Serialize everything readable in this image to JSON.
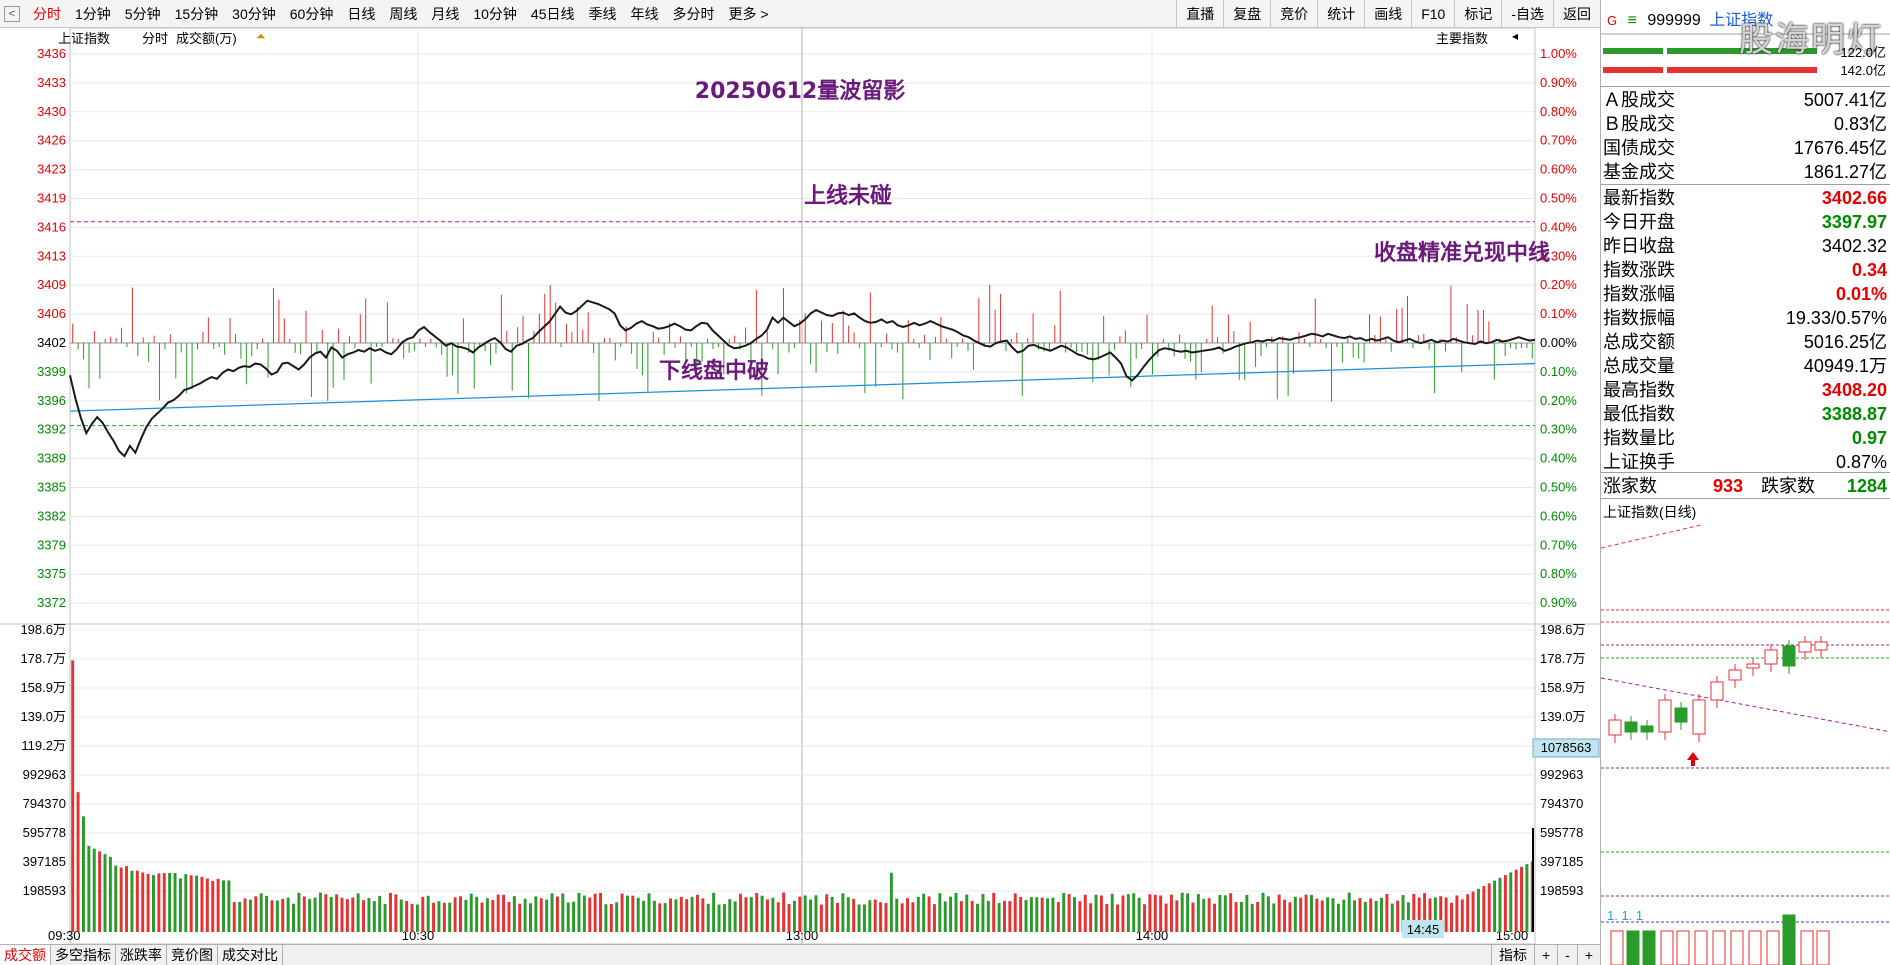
{
  "toolbar": {
    "back_label": "<",
    "period_tabs": [
      "分时",
      "1分钟",
      "5分钟",
      "15分钟",
      "30分钟",
      "60分钟",
      "日线",
      "周线",
      "月线",
      "10分钟",
      "45日线",
      "季线",
      "年线",
      "多分时",
      "更多 >"
    ],
    "tool_buttons": [
      "直播",
      "复盘",
      "竞价",
      "统计",
      "画线",
      "F10",
      "标记",
      "-自选",
      "返回"
    ]
  },
  "chart": {
    "header": {
      "index_name": "上证指数",
      "mode": "分时",
      "indicator": "成交额(万)",
      "main_indicator": "主要指数"
    },
    "annotations": {
      "title": "20250612量波留影",
      "upper": "上线未碰",
      "lower": "下线盘中破",
      "close": "收盘精准兑现中线"
    },
    "cursor_value": "1078563",
    "time_cursor": "14:45"
  },
  "chart_data": {
    "type": "line",
    "title": "",
    "price_axis": [
      "3436",
      "3433",
      "3430",
      "3426",
      "3423",
      "3419",
      "3416",
      "3413",
      "3409",
      "3406",
      "3402",
      "3399",
      "3396",
      "3392",
      "3389",
      "3385",
      "3382",
      "3379",
      "3375",
      "3372"
    ],
    "pct_axis": [
      "1.00%",
      "0.90%",
      "0.80%",
      "0.70%",
      "0.60%",
      "0.50%",
      "0.40%",
      "0.30%",
      "0.20%",
      "0.10%",
      "0.00%",
      "0.10%",
      "0.20%",
      "0.30%",
      "0.40%",
      "0.50%",
      "0.60%",
      "0.70%",
      "0.80%",
      "0.90%"
    ],
    "volume_axis_left": [
      "198.6万",
      "178.7万",
      "158.9万",
      "139.0万",
      "119.2万",
      "992963",
      "794370",
      "595778",
      "397185",
      "198593"
    ],
    "volume_axis_right": [
      "198.6万",
      "178.7万",
      "158.9万",
      "139.0万",
      "119.2万",
      "992963",
      "794370",
      "595778",
      "397185",
      "198593"
    ],
    "time_axis": [
      "09:30",
      "10:30",
      "13:00",
      "14:00",
      "15:00"
    ],
    "prev_close": 3402.32,
    "upper_line": 3416.6,
    "lower_line": 3392.6,
    "price_series": [
      3398.5,
      3395.8,
      3393.5,
      3391.7,
      3392.8,
      3393.6,
      3392.9,
      3391.8,
      3390.8,
      3389.6,
      3389.0,
      3390.2,
      3389.4,
      3391.0,
      3392.4,
      3393.4,
      3394.0,
      3394.6,
      3395.3,
      3395.6,
      3396.1,
      3396.8,
      3397.0,
      3397.3,
      3397.6,
      3398.0,
      3398.3,
      3398.1,
      3398.8,
      3399.2,
      3399.0,
      3399.4,
      3399.6,
      3399.5,
      3399.9,
      3399.8,
      3399.3,
      3398.6,
      3398.9,
      3399.9,
      3400.0,
      3399.6,
      3399.2,
      3399.8,
      3400.6,
      3401.1,
      3401.3,
      3400.6,
      3401.8,
      3401.4,
      3400.6,
      3401.0,
      3401.2,
      3401.5,
      3401.3,
      3401.7,
      3401.4,
      3401.6,
      3401.2,
      3401.0,
      3401.6,
      3402.4,
      3402.8,
      3403.0,
      3403.8,
      3404.2,
      3403.6,
      3403.1,
      3402.6,
      3402.0,
      3402.3,
      3401.9,
      3401.8,
      3401.6,
      3401.2,
      3401.8,
      3402.2,
      3402.6,
      3402.9,
      3402.4,
      3401.6,
      3401.3,
      3402.0,
      3402.2,
      3402.6,
      3402.9,
      3403.6,
      3404.2,
      3404.8,
      3405.7,
      3406.6,
      3405.9,
      3405.7,
      3406.1,
      3406.7,
      3407.3,
      3407.1,
      3406.9,
      3406.6,
      3406.3,
      3405.8,
      3404.4,
      3403.8,
      3404.1,
      3404.6,
      3404.9,
      3404.5,
      3404.3,
      3404.0,
      3404.1,
      3404.3,
      3404.6,
      3404.3,
      3403.9,
      3403.8,
      3404.3,
      3404.7,
      3404.6,
      3403.8,
      3403.2,
      3402.6,
      3402.0,
      3401.7,
      3401.8,
      3402.0,
      3402.3,
      3402.8,
      3403.2,
      3403.9,
      3405.3,
      3404.7,
      3405.3,
      3404.8,
      3404.3,
      3404.6,
      3405.1,
      3405.8,
      3406.2,
      3405.9,
      3405.6,
      3405.5,
      3405.8,
      3405.9,
      3405.6,
      3405.8,
      3405.3,
      3404.9,
      3404.7,
      3404.8,
      3405.1,
      3404.7,
      3404.9,
      3404.4,
      3404.2,
      3404.4,
      3404.7,
      3404.4,
      3404.6,
      3404.9,
      3404.6,
      3404.3,
      3404.1,
      3403.9,
      3403.6,
      3403.2,
      3403.0,
      3402.6,
      3402.3,
      3402.0,
      3401.9,
      3402.3,
      3402.5,
      3402.6,
      3401.8,
      3401.2,
      3401.4,
      3402.0,
      3402.1,
      3401.8,
      3401.6,
      3401.4,
      3401.7,
      3402.0,
      3401.8,
      3401.4,
      3401.0,
      3400.8,
      3400.5,
      3400.4,
      3400.6,
      3400.9,
      3401.2,
      3400.6,
      3399.9,
      3398.4,
      3397.9,
      3398.5,
      3399.4,
      3400.2,
      3400.9,
      3401.5,
      3401.7,
      3401.6,
      3401.4,
      3401.3,
      3401.4,
      3401.2,
      3401.3,
      3401.4,
      3401.5,
      3401.6,
      3401.8,
      3401.4,
      3401.6,
      3401.9,
      3402.1,
      3402.3,
      3402.4,
      3402.6,
      3402.5,
      3402.7,
      3402.6,
      3402.9,
      3402.8,
      3402.7,
      3402.9,
      3403.0,
      3403.2,
      3403.4,
      3403.3,
      3403.1,
      3403.4,
      3403.2,
      3403.0,
      3402.9,
      3403.1,
      3402.8,
      3402.9,
      3402.6,
      3402.8,
      3402.6,
      3402.8,
      3403.0,
      3402.6,
      3402.4,
      3402.6,
      3402.8,
      3402.5,
      3402.3,
      3402.5,
      3402.7,
      3402.4,
      3402.6,
      3402.5,
      3402.8,
      3402.6,
      3402.4,
      3402.3,
      3402.2,
      3402.5,
      3402.3,
      3402.4,
      3402.7,
      3402.5,
      3402.6,
      3402.8,
      3403.0,
      3402.8,
      3402.6,
      3402.7
    ],
    "avg_series_start": 3394.3,
    "avg_series_end": 3399.9,
    "volume_max": 1986000
  },
  "right_panel": {
    "marker": "G",
    "menu_icon": "≡",
    "code": "999999",
    "name": "上证指数",
    "bar_values": [
      "122.0亿",
      "142.0亿"
    ],
    "turnover": [
      {
        "label": "Ａ股成交",
        "value": "5007.41亿"
      },
      {
        "label": "Ｂ股成交",
        "value": "0.83亿"
      },
      {
        "label": "国债成交",
        "value": "17676.45亿"
      },
      {
        "label": "基金成交",
        "value": "1861.27亿"
      }
    ],
    "stats": [
      {
        "label": "最新指数",
        "value": "3402.66",
        "color": "#e60000"
      },
      {
        "label": "今日开盘",
        "value": "3397.97",
        "color": "#008a00"
      },
      {
        "label": "昨日收盘",
        "value": "3402.32",
        "color": "#000000"
      },
      {
        "label": "指数涨跌",
        "value": "0.34",
        "color": "#e60000"
      },
      {
        "label": "指数涨幅",
        "value": "0.01%",
        "color": "#e60000"
      },
      {
        "label": "指数振幅",
        "value": "19.33/0.57%",
        "color": "#000000"
      },
      {
        "label": "总成交额",
        "value": "5016.25亿",
        "color": "#000000"
      },
      {
        "label": "总成交量",
        "value": "40949.1万",
        "color": "#000000"
      },
      {
        "label": "最高指数",
        "value": "3408.20",
        "color": "#e60000"
      },
      {
        "label": "最低指数",
        "value": "3388.87",
        "color": "#008a00"
      },
      {
        "label": "指数量比",
        "value": "0.97",
        "color": "#008a00"
      },
      {
        "label": "上证换手",
        "value": "0.87%",
        "color": "#000000"
      }
    ],
    "breadth": {
      "up_label": "涨家数",
      "up_value": "933",
      "down_label": "跌家数",
      "down_value": "1284"
    },
    "kline_title": "上证指数(日线)",
    "kline_label": "1. 1. 1",
    "watermark": "股海明灯"
  },
  "bottom_bar": {
    "tabs": [
      "成交额",
      "多空指标",
      "涨跌率",
      "竞价图",
      "成交对比"
    ],
    "right_buttons": [
      "指标",
      "+",
      "-",
      "+"
    ]
  }
}
